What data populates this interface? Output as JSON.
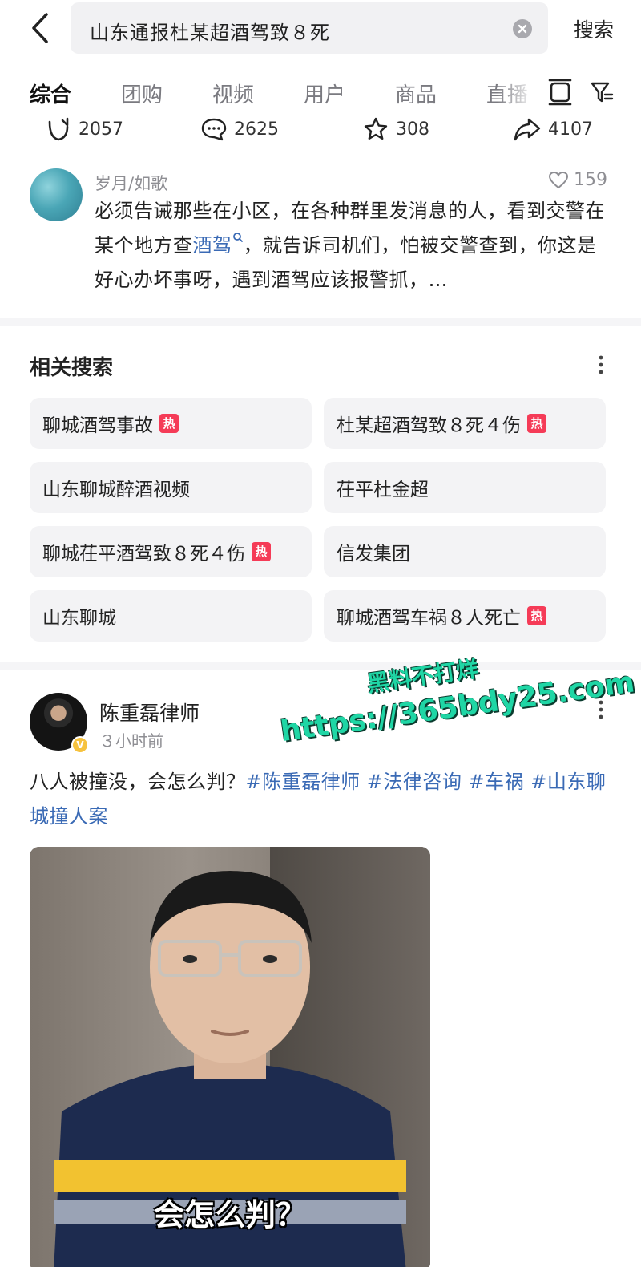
{
  "search": {
    "query": "山东通报杜某超酒驾致８死",
    "button_label": "搜索"
  },
  "tabs": [
    {
      "label": "综合",
      "active": true
    },
    {
      "label": "团购"
    },
    {
      "label": "视频"
    },
    {
      "label": "用户"
    },
    {
      "label": "商品"
    },
    {
      "label": "直播"
    }
  ],
  "stats": {
    "repost": "2057",
    "comments": "2625",
    "favorites": "308",
    "shares": "4107"
  },
  "comment": {
    "author": "岁月/如歌",
    "likes": "159",
    "text_before": "必须告诫那些在小区，在各种群里发消息的人，看到交警在某个地方查",
    "link": "酒驾",
    "text_after": "，就告诉司机们，怕被交警查到，你这是好心办坏事呀，遇到酒驾应该报警抓，…"
  },
  "related": {
    "title": "相关搜索",
    "hot_badge": "热",
    "items": [
      {
        "label": "聊城酒驾事故",
        "hot": true
      },
      {
        "label": "杜某超酒驾致８死４伤",
        "hot": true
      },
      {
        "label": "山东聊城醉酒视频",
        "hot": false
      },
      {
        "label": "茌平杜金超",
        "hot": false
      },
      {
        "label": "聊城茌平酒驾致８死４伤",
        "hot": true
      },
      {
        "label": "信发集团",
        "hot": false
      },
      {
        "label": "山东聊城",
        "hot": false
      },
      {
        "label": "聊城酒驾车祸８人死亡",
        "hot": true
      }
    ]
  },
  "post": {
    "author": "陈重磊律师",
    "time": "３小时前",
    "text": "八人被撞没，会怎么判？",
    "tags": [
      "#陈重磊律师",
      "#法律咨询",
      "#车祸",
      "#山东聊城撞人案"
    ],
    "video_caption": "会怎么判？"
  },
  "watermark": {
    "line1": "黑料不打烊",
    "line2": "https://365bdy25.com"
  },
  "colors": {
    "link": "#3a6ab5",
    "hot": "#f53b57",
    "chip_bg": "#f3f3f5",
    "watermark": "#1fd6a5"
  }
}
